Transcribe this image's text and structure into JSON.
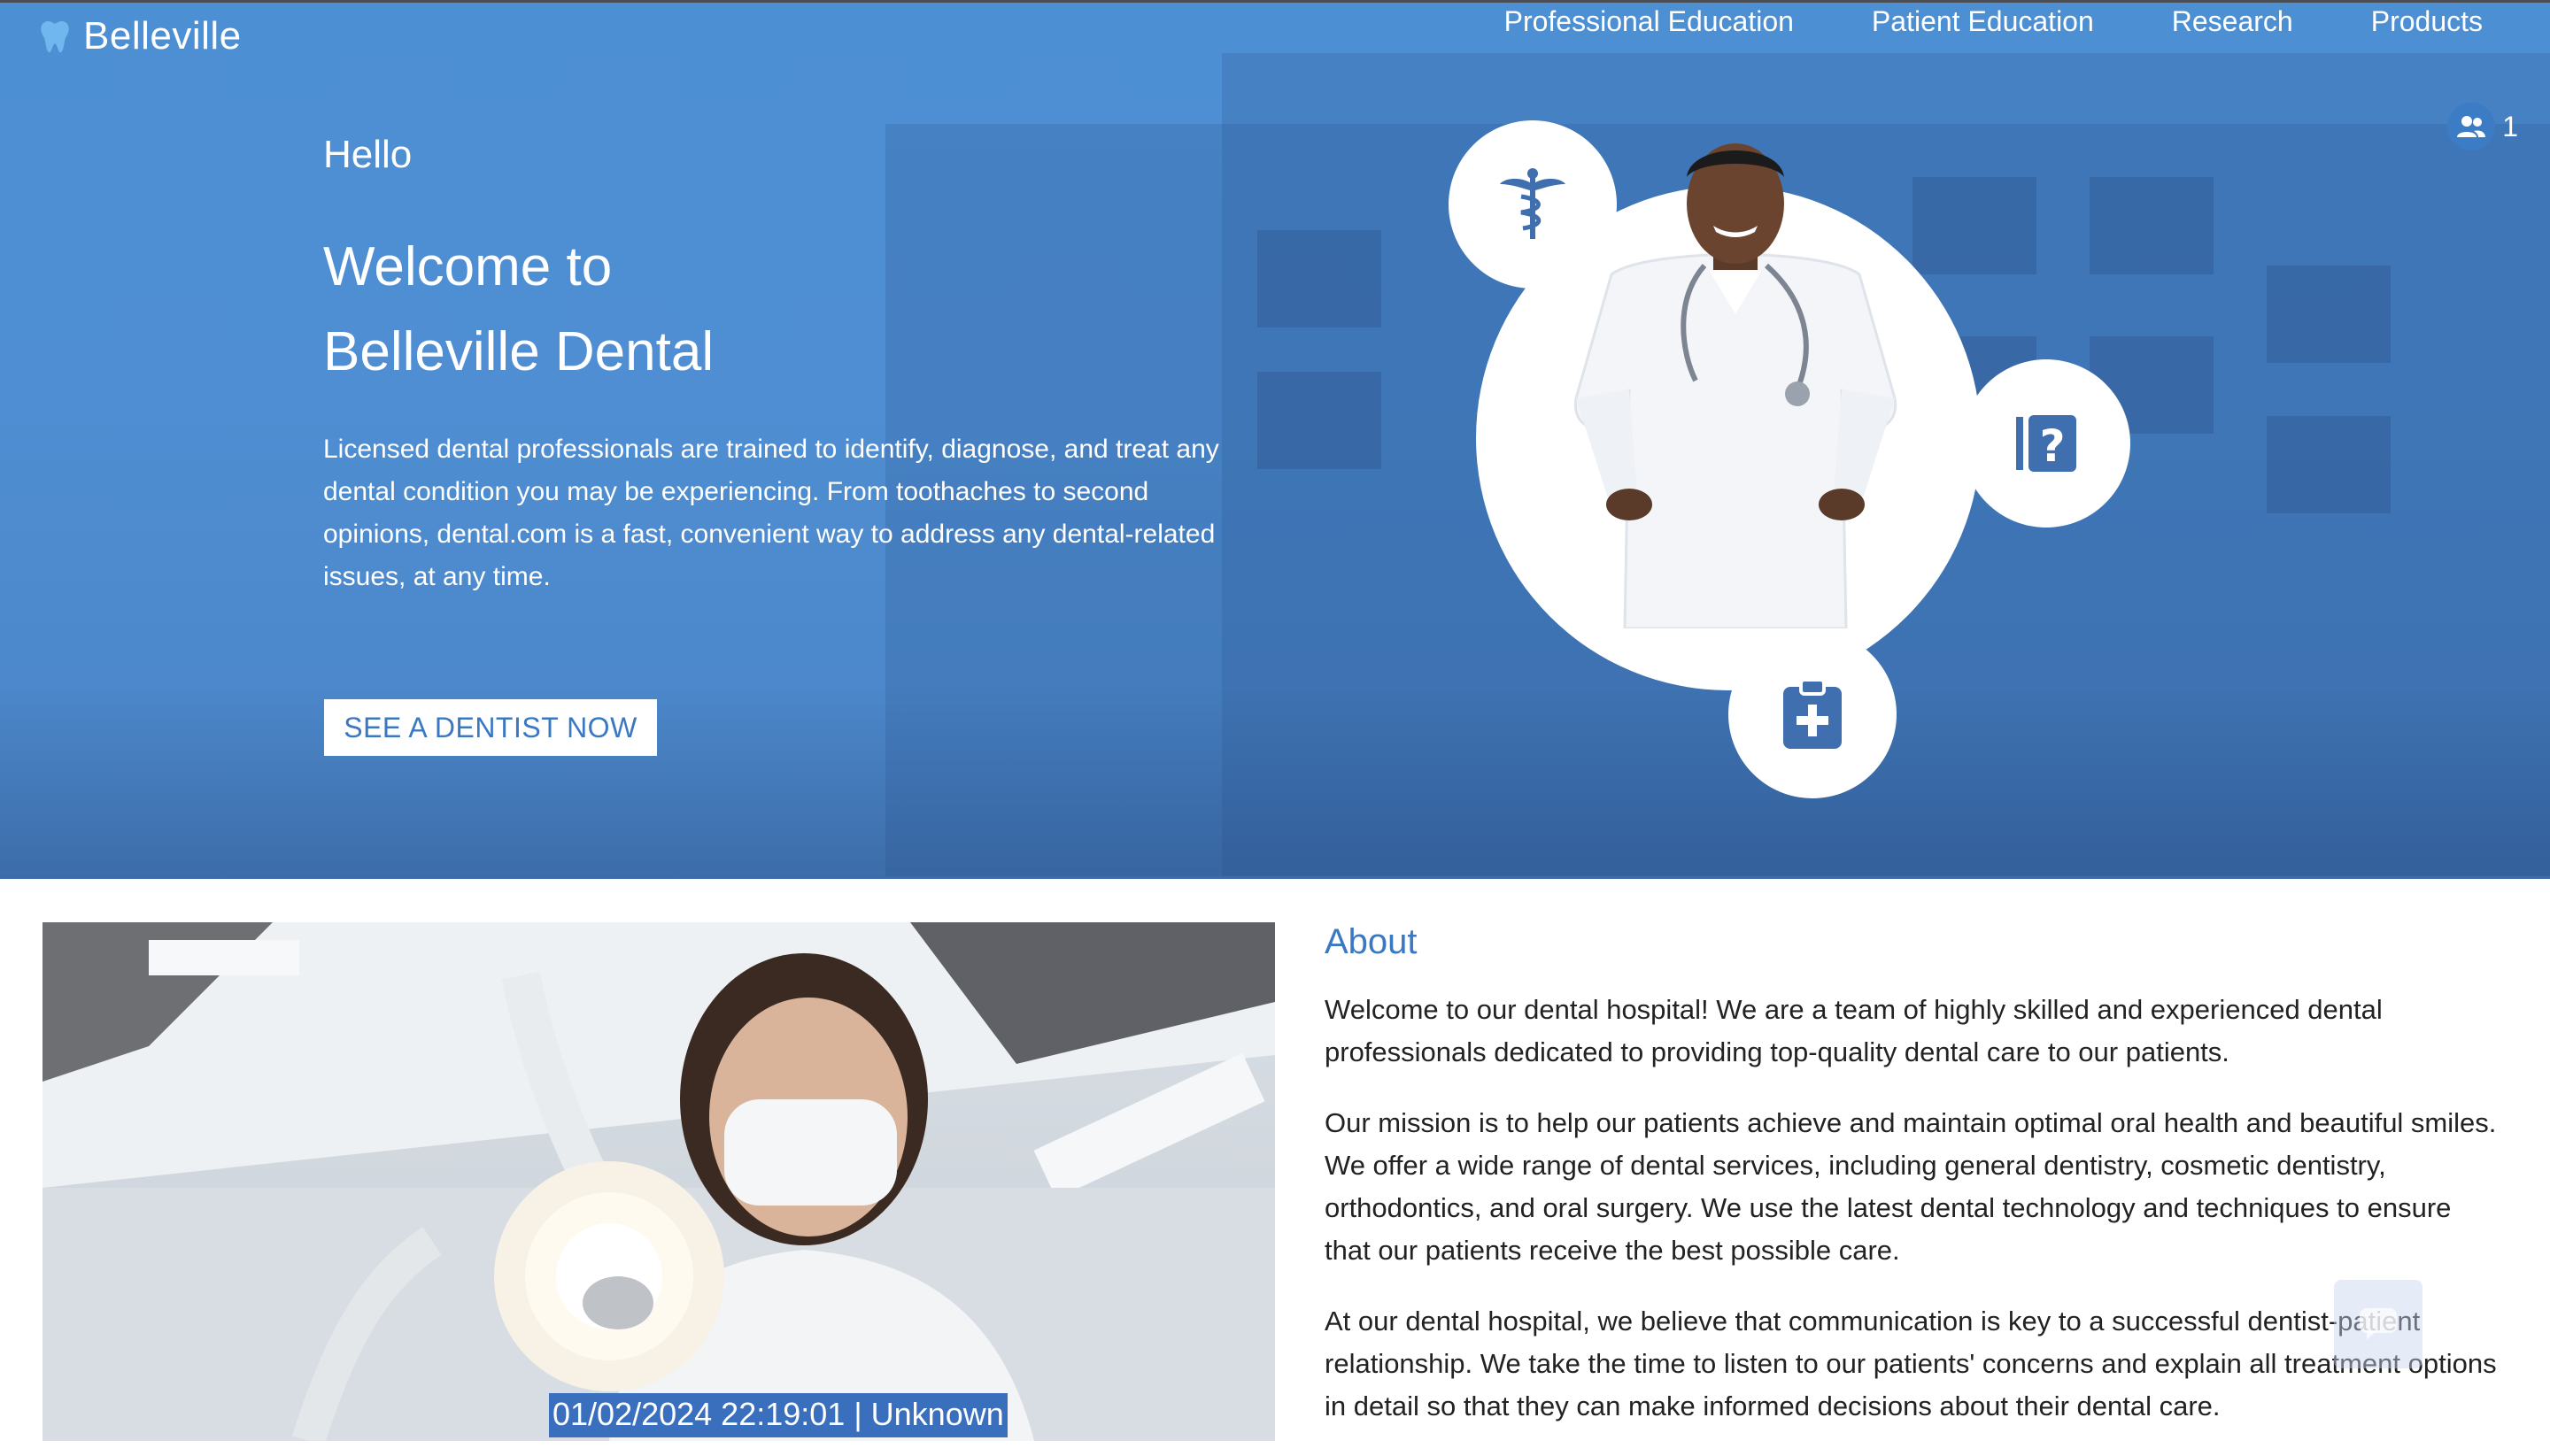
{
  "brand": {
    "name": "Belleville",
    "icon": "tooth-icon"
  },
  "nav": {
    "items": [
      {
        "label": "Professional Education"
      },
      {
        "label": "Patient Education"
      },
      {
        "label": "Research"
      },
      {
        "label": "Products"
      }
    ]
  },
  "users_badge": {
    "icon": "users-icon",
    "count": "1"
  },
  "hero": {
    "greeting": "Hello",
    "title_line1": "Welcome to",
    "title_line2": "Belleville Dental",
    "description": "Licensed dental professionals are trained to identify, diagnose, and treat any dental condition you may be experiencing. From toothaches to second opinions, dental.com is a fast, convenient way to address any dental-related issues, at any time.",
    "cta_label": "SEE A DENTIST NOW",
    "circle_icons": [
      "caduceus-icon",
      "question-clipboard-icon",
      "medical-clipboard-icon"
    ]
  },
  "photo": {
    "caption": "01/02/2024 22:19:01 | Unknown"
  },
  "about": {
    "heading": "About",
    "paragraphs": [
      "Welcome to our dental hospital! We are a team of highly skilled and experienced dental professionals dedicated to providing top-quality dental care to our patients.",
      "Our mission is to help our patients achieve and maintain optimal oral health and beautiful smiles. We offer a wide range of dental services, including general dentistry, cosmetic dentistry, orthodontics, and oral surgery. We use the latest dental technology and techniques to ensure that our patients receive the best possible care.",
      "At our dental hospital, we believe that communication is key to a successful dentist-patient relationship. We take the time to listen to our patients' concerns and explain all treatment options in detail so that they can make informed decisions about their dental care."
    ]
  },
  "colors": {
    "hero_blue": "#4d8fd3",
    "accent": "#3a78c3",
    "caption_bg": "#3a6fbd",
    "body_text": "#222222"
  }
}
